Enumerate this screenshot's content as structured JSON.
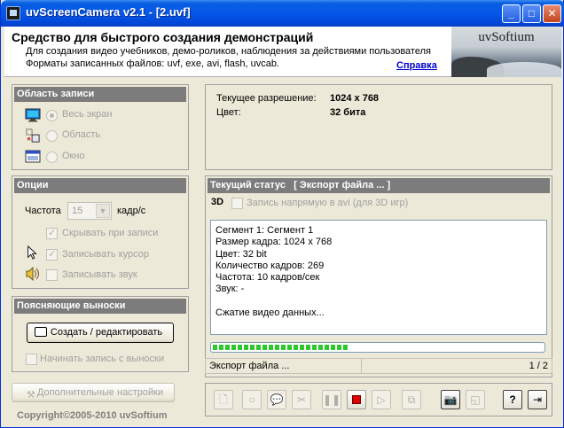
{
  "window": {
    "title": "uvScreenCamera v2.1 - [2.uvf]"
  },
  "banner": {
    "title": "Средство для быстрого создания демонстраций",
    "line1": "Для создания видео учебников, демо-роликов, наблюдения за действиями пользователя",
    "line2": "Форматы записанных файлов: uvf, exe, avi, flash, uvcab.",
    "help_link": "Справка",
    "brand": "uvSoftium"
  },
  "record_area": {
    "header": "Область записи",
    "options": [
      "Весь экран",
      "Область",
      "Окно"
    ],
    "selected": "Весь экран"
  },
  "options": {
    "header": "Опции",
    "frequency_label": "Частота",
    "frequency_value": "15",
    "frequency_unit": "кадр/с",
    "hide_while_recording": "Скрывать при записи",
    "record_cursor": "Записывать курсор",
    "record_sound": "Записывать звук"
  },
  "callouts": {
    "header": "Поясняющие выноски",
    "create_button": "Создать / редактировать",
    "start_with_callout": "Начинать запись с выноски"
  },
  "additional_settings_button": "Дополнительные настройки",
  "copyright": "Copyright©2005-2010 uvSoftium",
  "info": {
    "resolution_label": "Текущее разрешение:",
    "resolution_value": "1024 х 768",
    "color_label": "Цвет:",
    "color_value": "32 бита"
  },
  "status": {
    "header": "Текущий статус   [ Экспорт файла ... ]",
    "tag_3d": "3D",
    "record_avi": "Запись напрямую в avi (для 3D игр)",
    "log": [
      "Сегмент 1: Сегмент 1",
      "Размер кадра: 1024 х 768",
      "Цвет: 32 bit",
      "Количество кадров: 269",
      "Частота: 10 кадров/сек",
      "Звук: -",
      "",
      "Сжатие видео данных..."
    ],
    "progress": 0.42,
    "footer_text": "Экспорт файла ...",
    "page": "1 / 2"
  },
  "colors": {
    "accent": "#0558e8",
    "progress": "#2ec72e",
    "header_bg": "#7c7c7c"
  },
  "toolbar_icons": [
    "new-file-icon",
    "record-icon",
    "callout-icon",
    "cut-icon",
    "pause-icon",
    "stop-icon",
    "play-icon",
    "copy-icon",
    "camera-icon",
    "preview-icon",
    "help-icon",
    "exit-icon"
  ]
}
